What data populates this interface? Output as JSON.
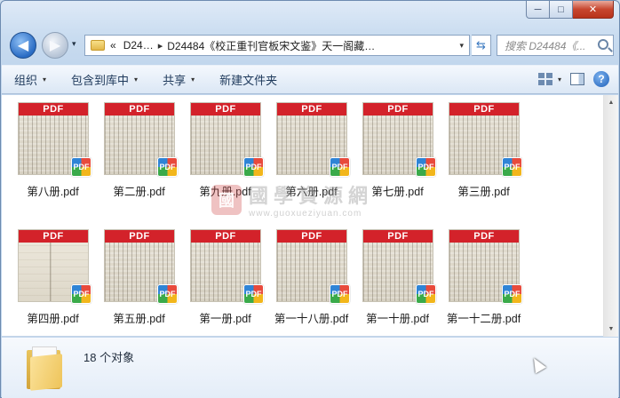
{
  "window": {
    "caption": {
      "minimize": "─",
      "maximize": "□",
      "close": "✕"
    }
  },
  "address_bar": {
    "back_glyph": "◀",
    "forward_glyph": "▶",
    "recent_glyph": "▾",
    "prefix": "«",
    "crumbs": [
      "D24…",
      "D24484《校正重刊官板宋文鉴》天一阁藏…"
    ],
    "separator": "▸",
    "dropdown_glyph": "▾",
    "refresh_glyph": "⇆"
  },
  "search": {
    "placeholder": "搜索 D24484《..."
  },
  "toolbar": {
    "organize": "组织",
    "include_in_library": "包含到库中",
    "share": "共享",
    "new_folder": "新建文件夹",
    "caret": "▾",
    "help": "?"
  },
  "files": [
    {
      "name": "第八册.pdf",
      "band": "PDF",
      "badge": "PDF"
    },
    {
      "name": "第二册.pdf",
      "band": "PDF",
      "badge": "PDF"
    },
    {
      "name": "第九册.pdf",
      "band": "PDF",
      "badge": "PDF"
    },
    {
      "name": "第六册.pdf",
      "band": "PDF",
      "badge": "PDF"
    },
    {
      "name": "第七册.pdf",
      "band": "PDF",
      "badge": "PDF"
    },
    {
      "name": "第三册.pdf",
      "band": "PDF",
      "badge": "PDF"
    },
    {
      "name": "第四册.pdf",
      "band": "PDF",
      "badge": "PDF"
    },
    {
      "name": "第五册.pdf",
      "band": "PDF",
      "badge": "PDF"
    },
    {
      "name": "第一册.pdf",
      "band": "PDF",
      "badge": "PDF"
    },
    {
      "name": "第一十八册.pdf",
      "band": "PDF",
      "badge": "PDF"
    },
    {
      "name": "第一十册.pdf",
      "band": "PDF",
      "badge": "PDF"
    },
    {
      "name": "第一十二册.pdf",
      "band": "PDF",
      "badge": "PDF"
    }
  ],
  "watermark": {
    "seal": "國",
    "title": "國學資源網",
    "url": "www.guoxueziyuan.com"
  },
  "scrollbar": {
    "up": "▲",
    "down": "▼"
  },
  "status": {
    "count": "18 个对象"
  }
}
